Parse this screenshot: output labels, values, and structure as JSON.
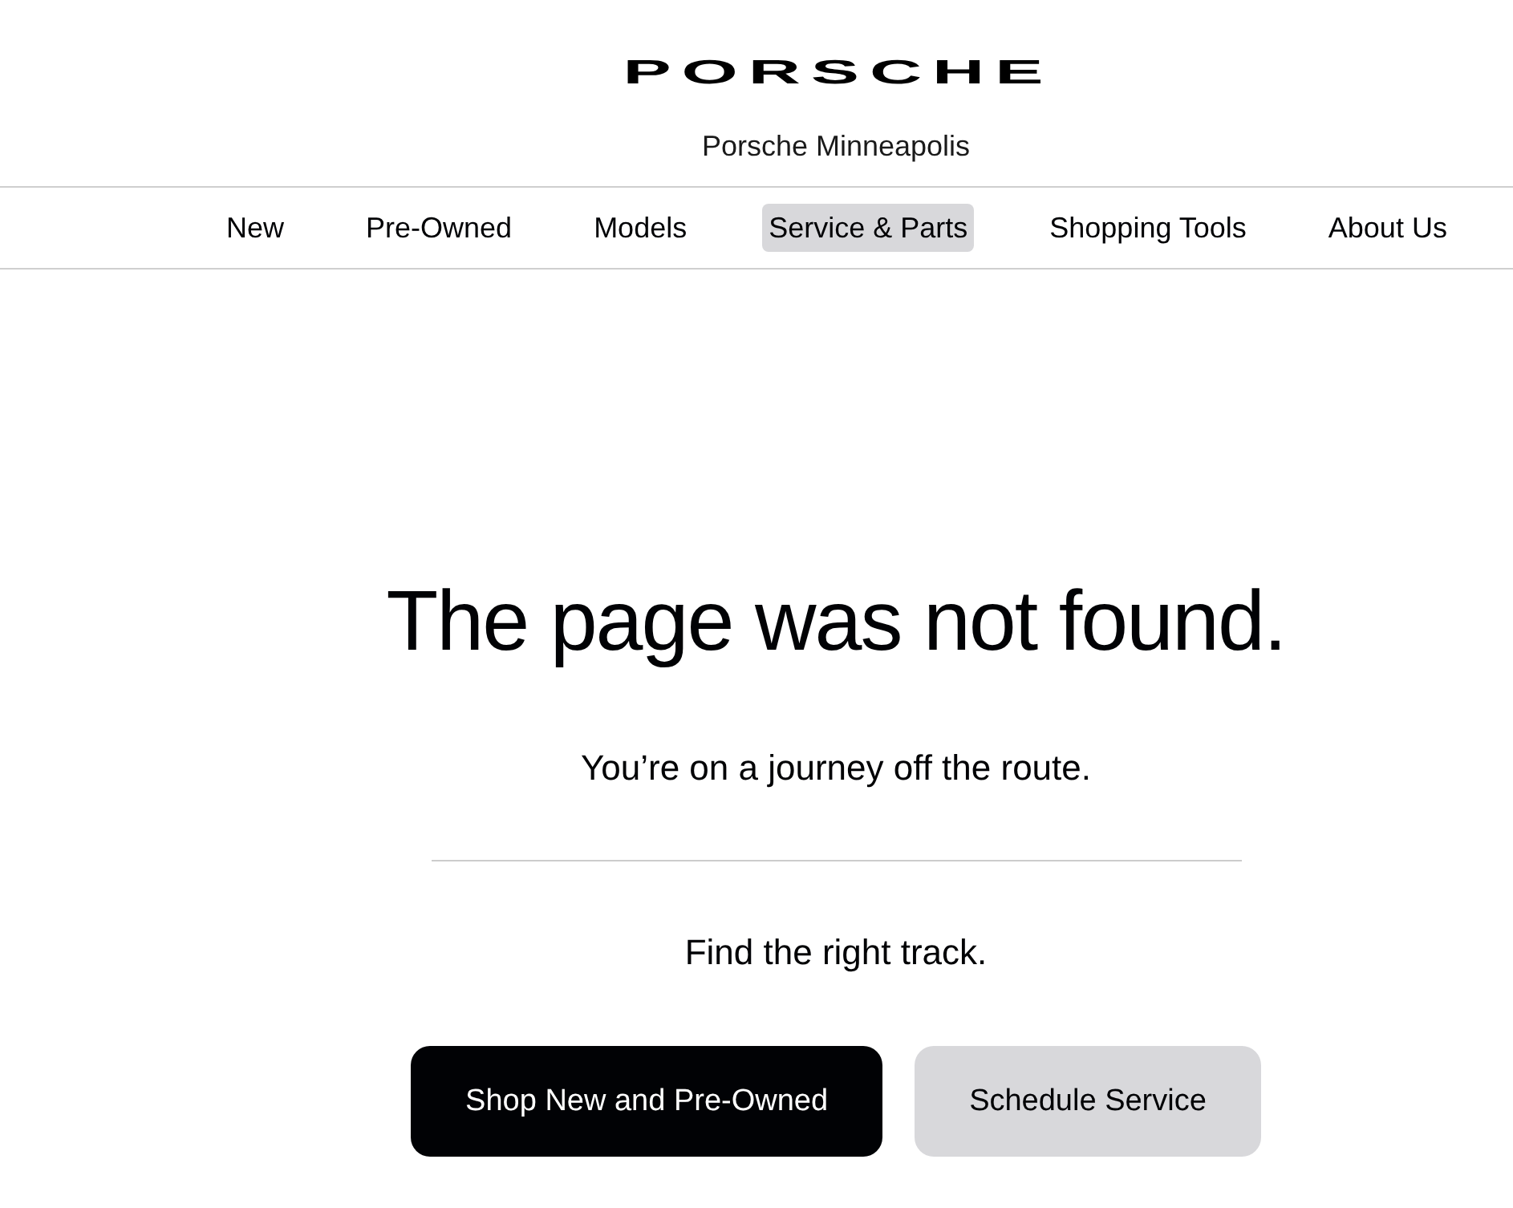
{
  "header": {
    "logo": "PORSCHE",
    "dealer_name": "Porsche Minneapolis"
  },
  "nav": {
    "items": [
      {
        "label": "New",
        "selected": false
      },
      {
        "label": "Pre-Owned",
        "selected": false
      },
      {
        "label": "Models",
        "selected": false
      },
      {
        "label": "Service & Parts",
        "selected": true
      },
      {
        "label": "Shopping Tools",
        "selected": false
      },
      {
        "label": "About Us",
        "selected": false
      }
    ]
  },
  "error": {
    "title": "The page was not found.",
    "subtitle": "You’re on a journey off the route.",
    "prompt": "Find the right track."
  },
  "buttons": [
    {
      "label": "Shop New and Pre-Owned",
      "kind": "primary"
    },
    {
      "label": "Schedule Service",
      "kind": "secondary"
    }
  ]
}
